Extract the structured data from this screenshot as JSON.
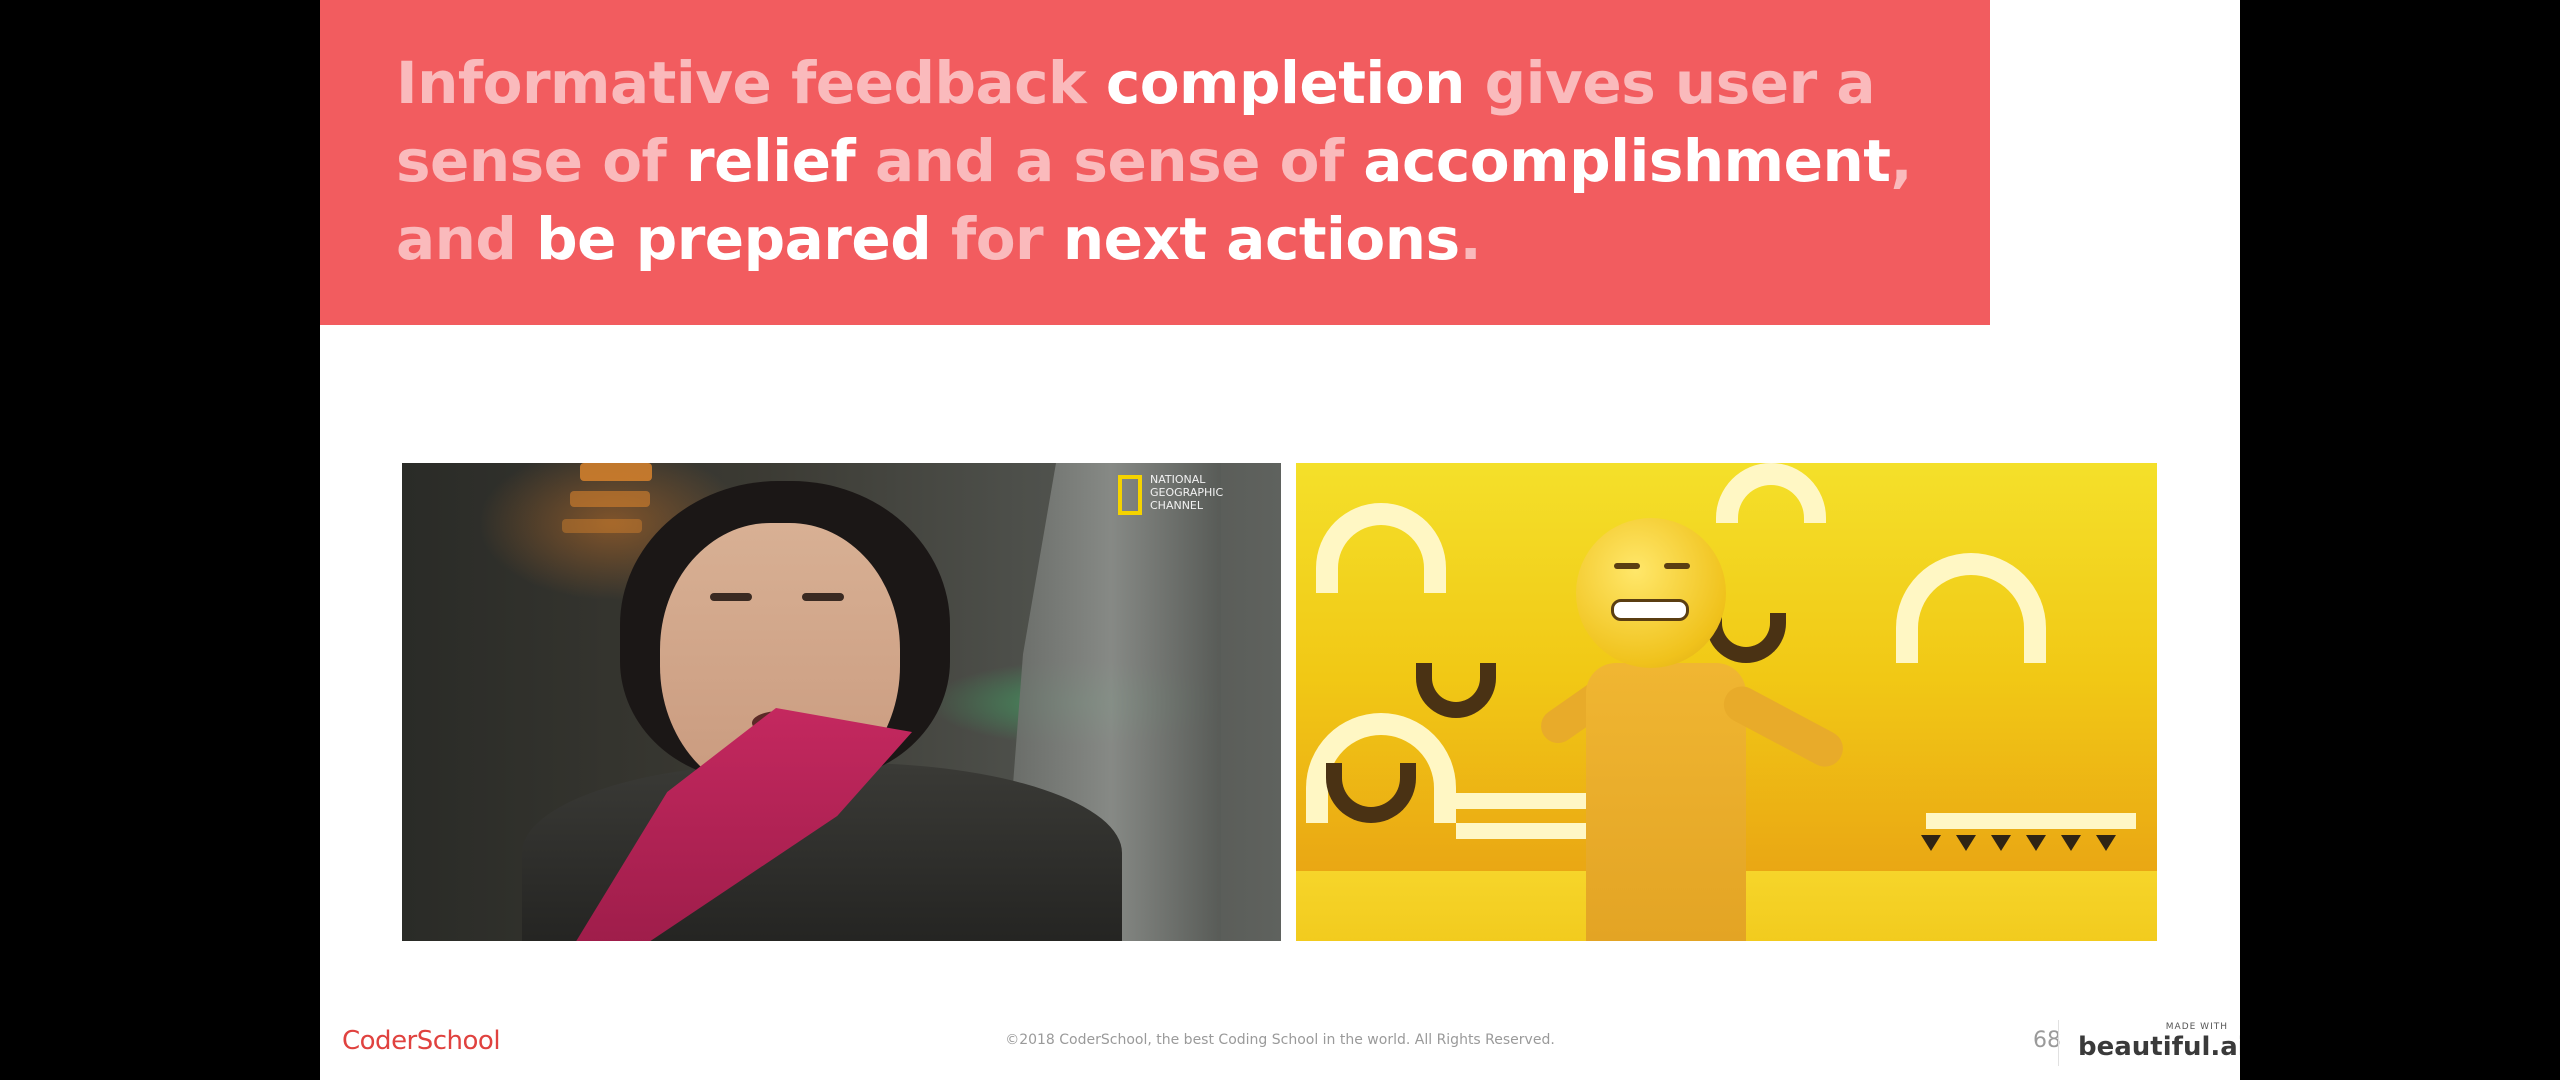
{
  "colors": {
    "accent": "#f25c5f",
    "brand_red": "#e0423f",
    "letterbox": "#000000",
    "slide_background": "#ffffff"
  },
  "headline": {
    "segments": [
      {
        "text": "Informative feedback ",
        "style": "muted"
      },
      {
        "text": "completion",
        "style": "strong"
      },
      {
        "text": " gives user a sense of ",
        "style": "muted"
      },
      {
        "text": "relief",
        "style": "strong"
      },
      {
        "text": " and a sense of ",
        "style": "muted"
      },
      {
        "text": "accomplishment",
        "style": "strong"
      },
      {
        "text": ", and ",
        "style": "muted"
      },
      {
        "text": "be prepared",
        "style": "strong"
      },
      {
        "text": " for ",
        "style": "muted"
      },
      {
        "text": "next actions",
        "style": "strong"
      },
      {
        "text": ".",
        "style": "muted"
      }
    ]
  },
  "media": {
    "left_gif": {
      "subject": "woman-with-pink-scarf",
      "channel_logo_text": "NATIONAL\nGEOGRAPHIC\nCHANNEL"
    },
    "right_gif": {
      "subject": "emoji-head-dancer"
    }
  },
  "footer": {
    "brand": "CoderSchool",
    "copyright": "©2018 CoderSchool, the best Coding School in the world. All Rights Reserved.",
    "page_number": "68",
    "made_with_label": "MADE WITH",
    "made_with_logo": "beautiful.ai"
  }
}
